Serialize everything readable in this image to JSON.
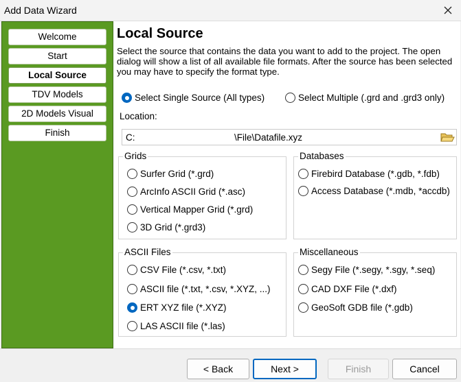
{
  "window": {
    "title": "Add Data Wizard",
    "close_glyph": "✕"
  },
  "sidebar": {
    "items": [
      {
        "label": "Welcome"
      },
      {
        "label": "Start"
      },
      {
        "label": "Local Source",
        "active": true
      },
      {
        "label": "TDV Models"
      },
      {
        "label": "2D Models Visual"
      },
      {
        "label": "Finish"
      }
    ]
  },
  "page": {
    "title": "Local Source",
    "description": "Select the source that contains the data you want to add to the project.  The open dialog will show a list of all available file formats. After the source has been selected you may have to specify the format type."
  },
  "source_mode": {
    "single": {
      "label": "Select Single Source (All types)",
      "checked": true
    },
    "multiple": {
      "label": "Select Multiple (.grd and .grd3 only)",
      "checked": false
    }
  },
  "location": {
    "label": "Location:",
    "drive": "C:",
    "path": "\\File\\Datafile.xyz",
    "browse_icon": "folder-open-icon"
  },
  "groups": {
    "grids": {
      "title": "Grids",
      "options": [
        {
          "label": "Surfer Grid (*.grd)"
        },
        {
          "label": "ArcInfo ASCII Grid (*.asc)"
        },
        {
          "label": "Vertical Mapper Grid (*.grd)"
        },
        {
          "label": "3D Grid (*.grd3)"
        }
      ]
    },
    "databases": {
      "title": "Databases",
      "options": [
        {
          "label": "Firebird Database (*.gdb, *.fdb)"
        },
        {
          "label": "Access Database (*.mdb, *accdb)"
        }
      ]
    },
    "ascii": {
      "title": "ASCII Files",
      "options": [
        {
          "label": "CSV File (*.csv, *.txt)"
        },
        {
          "label": "ASCII file (*.txt, *.csv, *.XYZ, ...)"
        },
        {
          "label": "ERT XYZ file (*.XYZ)",
          "checked": true
        },
        {
          "label": "LAS ASCII file (*.las)"
        }
      ]
    },
    "misc": {
      "title": "Miscellaneous",
      "options": [
        {
          "label": "Segy File (*.segy, *.sgy, *.seq)"
        },
        {
          "label": "CAD DXF File (*.dxf)"
        },
        {
          "label": "GeoSoft GDB file (*.gdb)"
        }
      ]
    }
  },
  "buttons": {
    "back": "< Back",
    "next": "Next >",
    "finish": "Finish",
    "cancel": "Cancel"
  },
  "colors": {
    "sidebar_bg": "#5a9a22",
    "accent": "#0067c0"
  }
}
